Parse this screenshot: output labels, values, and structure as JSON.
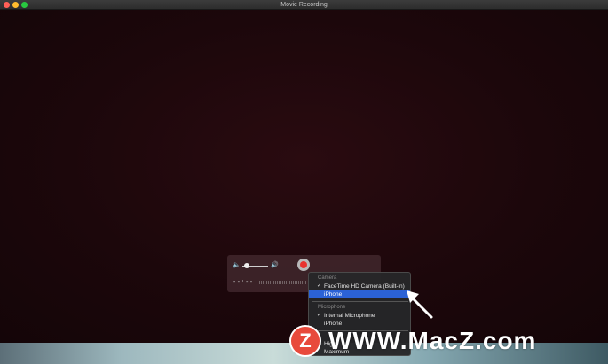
{
  "window": {
    "title": "Movie Recording"
  },
  "controls": {
    "volume_low_icon": "speaker-low-icon",
    "volume_high_icon": "speaker-high-icon",
    "volume_level": 0.1,
    "record_icon": "record-icon",
    "time": "--:--"
  },
  "menu": {
    "camera_header": "Camera",
    "camera_items": [
      {
        "label": "FaceTime HD Camera (Built-in)",
        "checked": true
      },
      {
        "label": "iPhone",
        "checked": false,
        "highlighted": true
      }
    ],
    "microphone_header": "Microphone",
    "microphone_items": [
      {
        "label": "Internal Microphone",
        "checked": true
      },
      {
        "label": "iPhone",
        "checked": false
      }
    ],
    "quality_items": [
      {
        "label": "High",
        "checked": true
      },
      {
        "label": "Maximum",
        "checked": false
      }
    ]
  },
  "watermark": {
    "logo_letter": "Z",
    "text": "WWW.MacZ.com"
  },
  "colors": {
    "record": "#e8322e",
    "selection": "#2b62d6",
    "logo": "#e84a3c"
  }
}
